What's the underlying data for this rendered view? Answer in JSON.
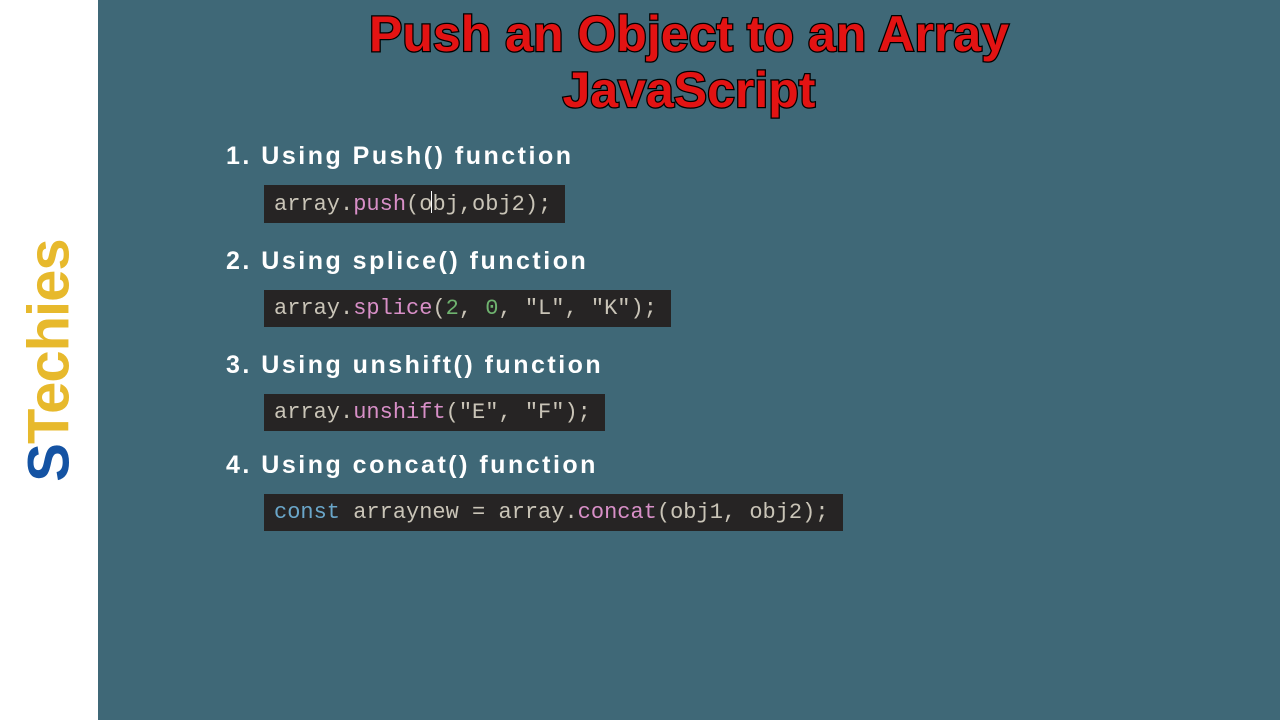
{
  "brand": {
    "s": "S",
    "rest": "Techies"
  },
  "title_line1": "Push an Object to an Array",
  "title_line2": "JavaScript",
  "sections": {
    "s1": {
      "heading": "1. Using Push() function",
      "code": {
        "obj": "array",
        "dot": ".",
        "fn": "push",
        "open": "(",
        "a1a": "o",
        "a1b": "bj",
        "comma": ",",
        "a2": "obj2",
        "close": ")",
        "semi": ";"
      }
    },
    "s2": {
      "heading": "2. Using splice() function",
      "code": {
        "obj": "array",
        "dot": ".",
        "fn": "splice",
        "open": "(",
        "n1": "2",
        "c1": ", ",
        "n2": "0",
        "c2": ", ",
        "s1": "\"L\"",
        "c3": ", ",
        "s2": "\"K\"",
        "close": ")",
        "semi": ";"
      }
    },
    "s3": {
      "heading": "3. Using unshift() function",
      "code": {
        "obj": "array",
        "dot": ".",
        "fn": "unshift",
        "open": "(",
        "s1": "\"E\"",
        "c1": ", ",
        "s2": "\"F\"",
        "close": ")",
        "semi": ";"
      }
    },
    "s4": {
      "heading": "4. Using concat() function",
      "code": {
        "kw": "const",
        "sp": " ",
        "var": "arraynew",
        "eq": " = ",
        "obj": "array",
        "dot": ".",
        "fn": "concat",
        "open": "(",
        "a1": "obj1",
        "c1": ", ",
        "a2": "obj2",
        "close": ")",
        "semi": ";"
      }
    }
  }
}
